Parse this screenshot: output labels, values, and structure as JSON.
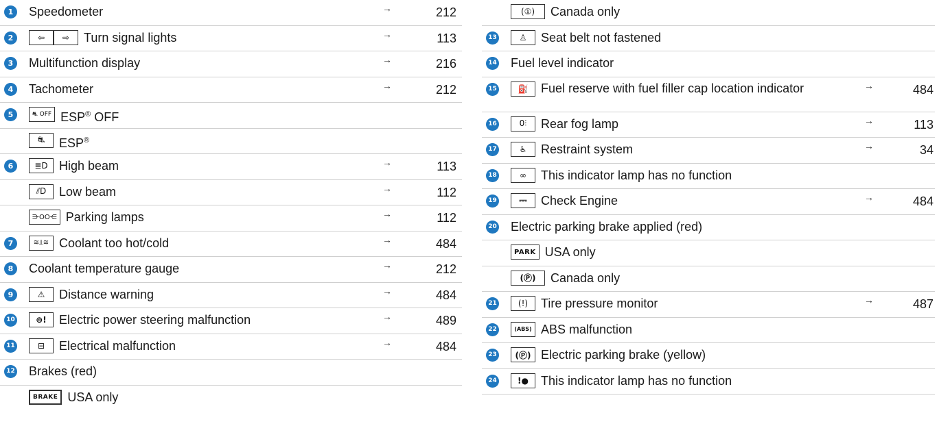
{
  "left": {
    "r1": {
      "num": "1",
      "label": "Speedometer",
      "arrow": "→",
      "page": "212"
    },
    "r2": {
      "num": "2",
      "icon_a": "⇦",
      "icon_b": "⇨",
      "label": "Turn signal lights",
      "arrow": "→",
      "page": "113"
    },
    "r3": {
      "num": "3",
      "label": "Multifunction display",
      "arrow": "→",
      "page": "216"
    },
    "r4": {
      "num": "4",
      "label": "Tachometer",
      "arrow": "→",
      "page": "212"
    },
    "r5": {
      "num": "5",
      "icon": "⛐ OFF",
      "label": "ESP",
      "sup": "®",
      "suffix": " OFF"
    },
    "r5b": {
      "icon": "⛐",
      "label": "ESP",
      "sup": "®"
    },
    "r6": {
      "num": "6",
      "icon": "≣D",
      "label": "High beam",
      "arrow": "→",
      "page": "113"
    },
    "r6b": {
      "icon": "⫽D",
      "label": "Low beam",
      "arrow": "→",
      "page": "112"
    },
    "r6c": {
      "icon": "⋺OO⋲",
      "label": "Parking lamps",
      "arrow": "→",
      "page": "112"
    },
    "r7": {
      "num": "7",
      "icon": "≋⫫≋",
      "label": "Coolant too hot/cold",
      "arrow": "→",
      "page": "484"
    },
    "r8": {
      "num": "8",
      "label": "Coolant temperature gauge",
      "arrow": "→",
      "page": "212"
    },
    "r9": {
      "num": "9",
      "icon": "⚠",
      "label": "Distance warning",
      "arrow": "→",
      "page": "484"
    },
    "r10": {
      "num": "10",
      "icon": "⊚!",
      "label": "Electric power steering malfunction",
      "arrow": "→",
      "page": "489"
    },
    "r11": {
      "num": "11",
      "icon": "⊟",
      "label": "Electrical malfunction",
      "arrow": "→",
      "page": "484"
    },
    "r12": {
      "num": "12",
      "label": "Brakes (red)"
    },
    "r12b": {
      "icon": "BRAKE",
      "label": "USA only"
    }
  },
  "right": {
    "r12c": {
      "icon": "(①)",
      "label": "Canada only"
    },
    "r13": {
      "num": "13",
      "icon": "♙",
      "label": "Seat belt not fastened"
    },
    "r14": {
      "num": "14",
      "label": "Fuel level indicator"
    },
    "r15": {
      "num": "15",
      "icon": "⛽",
      "label": "Fuel reserve with fuel filler cap location indicator",
      "arrow": "→",
      "page": "484"
    },
    "r16": {
      "num": "16",
      "icon": "0⫶",
      "label": "Rear fog lamp",
      "arrow": "→",
      "page": "113"
    },
    "r17": {
      "num": "17",
      "icon": "♿",
      "label": "Restraint system",
      "arrow": "→",
      "page": "34"
    },
    "r18": {
      "num": "18",
      "icon": "∞",
      "label": "This indicator lamp has no function"
    },
    "r19": {
      "num": "19",
      "icon": "⎓",
      "label": "Check Engine",
      "arrow": "→",
      "page": "484"
    },
    "r20": {
      "num": "20",
      "label": "Electric parking brake applied (red)"
    },
    "r20b": {
      "icon": "PARK",
      "label": "USA only"
    },
    "r20c": {
      "icon": "(Ⓟ)",
      "label": "Canada only"
    },
    "r21": {
      "num": "21",
      "icon": "(!)",
      "label": "Tire pressure monitor",
      "arrow": "→",
      "page": "487"
    },
    "r22": {
      "num": "22",
      "icon": "(ABS)",
      "label": "ABS malfunction"
    },
    "r23": {
      "num": "23",
      "icon": "(Ⓟ)",
      "label": "Electric parking brake (yellow)"
    },
    "r24": {
      "num": "24",
      "icon": "!●",
      "label": "This indicator lamp has no function"
    }
  }
}
